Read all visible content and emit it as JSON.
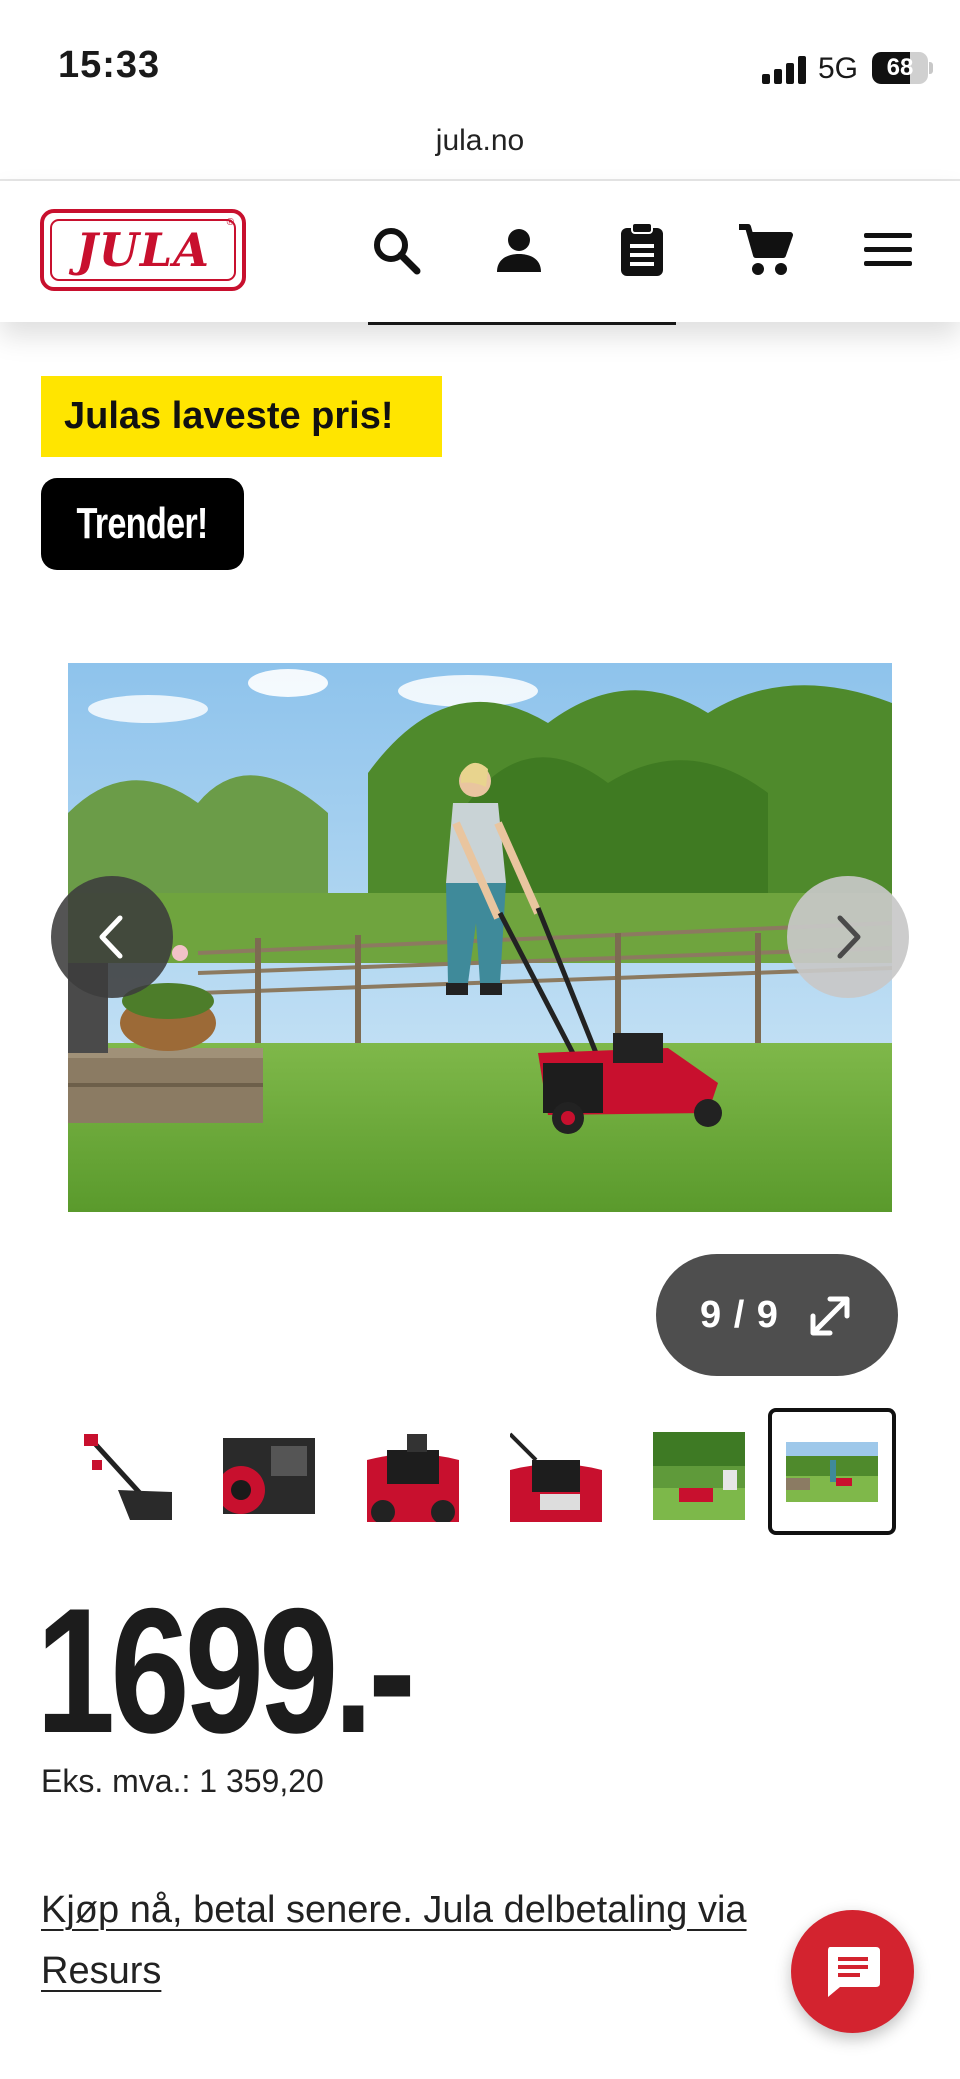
{
  "status_bar": {
    "time": "15:33",
    "network": "5G",
    "battery": "68",
    "battery_level": 0.68,
    "url": "jula.no"
  },
  "header": {
    "logo_text": "JULA",
    "logo_registered": "®",
    "brand_color": "#c8102e",
    "icons": [
      "search-icon",
      "account-icon",
      "clipboard-icon",
      "cart-icon",
      "menu-icon"
    ]
  },
  "badges": {
    "lowest_price": "Julas laveste pris!",
    "trend": "Trender!",
    "lowest_price_color": "#ffe500"
  },
  "gallery": {
    "counter": "9 / 9",
    "current": 9,
    "total": 9,
    "thumbnail_count": 6,
    "active_thumbnail": 6
  },
  "price": {
    "amount": "1699.-",
    "ex_vat": "Eks. mva.: 1 359,20"
  },
  "finance": {
    "link": "Kjøp nå, betal senere. Jula delbetaling via Resurs"
  },
  "chat": {
    "button_color": "#d3232f"
  }
}
